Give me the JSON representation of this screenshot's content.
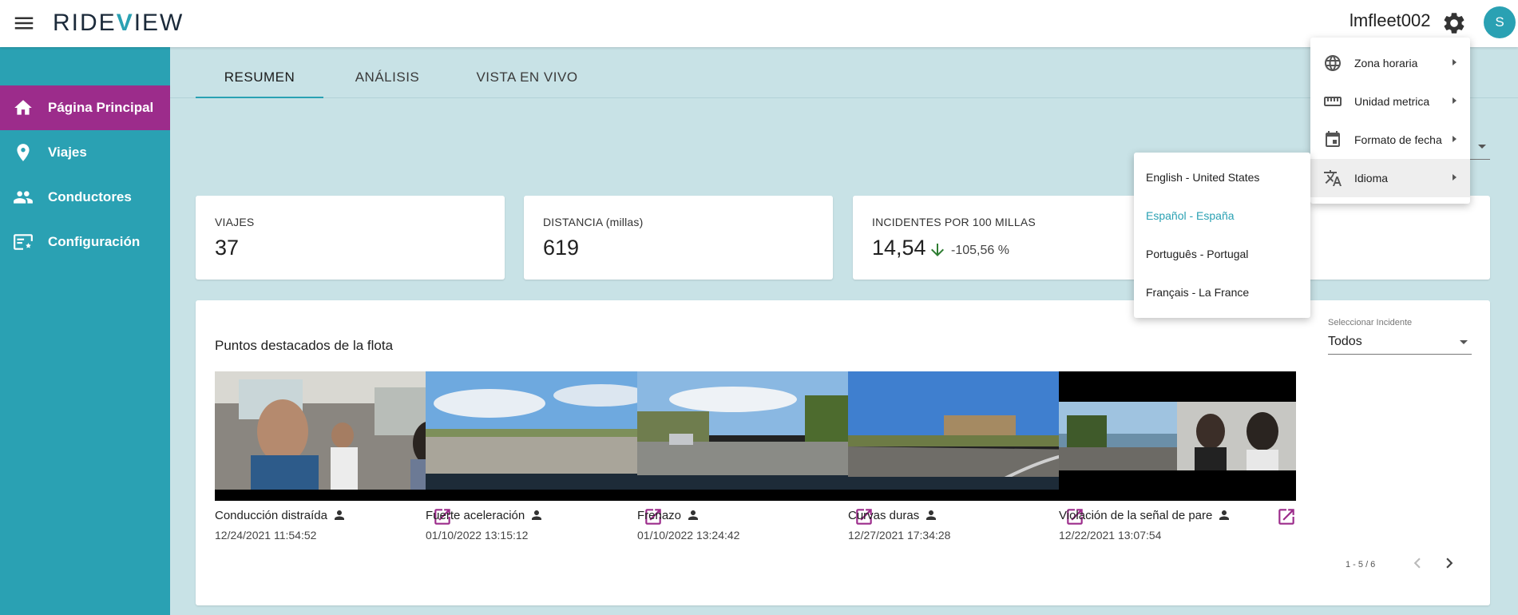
{
  "topbar": {
    "logo_left": "RIDE",
    "logo_v": "V",
    "logo_right": "IEW",
    "user_name": "lmfleet002",
    "avatar_initial": "S"
  },
  "sidebar": {
    "items": [
      {
        "label": "Página Principal",
        "icon": "home-icon"
      },
      {
        "label": "Viajes",
        "icon": "location-pin-icon"
      },
      {
        "label": "Conductores",
        "icon": "people-icon"
      },
      {
        "label": "Configuración",
        "icon": "settings-screen-icon"
      }
    ]
  },
  "tabs": [
    {
      "label": "RESUMEN"
    },
    {
      "label": "ANÁLISIS"
    },
    {
      "label": "VISTA EN VIVO"
    }
  ],
  "stats": [
    {
      "title": "VIAJES",
      "value": "37"
    },
    {
      "title": "DISTANCIA (millas)",
      "value": "619"
    },
    {
      "title": "INCIDENTES POR 100 MILLAS",
      "value": "14,54",
      "trend": "-105,56 %"
    }
  ],
  "highlights": {
    "title": "Puntos destacados de la flota",
    "select_label": "Seleccionar Incidente",
    "select_value": "Todos",
    "clips": [
      {
        "label": "Conducción distraída",
        "time": "12/24/2021 11:54:52"
      },
      {
        "label": "Fuerte aceleración",
        "time": "01/10/2022 13:15:12"
      },
      {
        "label": "Frenazo",
        "time": "01/10/2022 13:24:42"
      },
      {
        "label": "Curvas duras",
        "time": "12/27/2021 17:34:28"
      },
      {
        "label": "Violación de la señal de pare",
        "time": "12/22/2021 13:07:54"
      }
    ],
    "pager": "1 - 5 / 6"
  },
  "settings_menu": {
    "items": [
      {
        "label": "Zona horaria",
        "icon": "globe-icon"
      },
      {
        "label": "Unidad metrica",
        "icon": "ruler-icon"
      },
      {
        "label": "Formato de fecha",
        "icon": "calendar-icon"
      },
      {
        "label": "Idioma",
        "icon": "translate-icon"
      }
    ]
  },
  "language_menu": {
    "items": [
      {
        "label": "English - United States"
      },
      {
        "label": "Español - España"
      },
      {
        "label": "Português - Portugal"
      },
      {
        "label": "Français - La France"
      }
    ],
    "selected": "Español - España"
  },
  "colors": {
    "brand": "#2aa1b3",
    "active_nav": "#9c2c8b",
    "background": "#c8e2e6"
  }
}
